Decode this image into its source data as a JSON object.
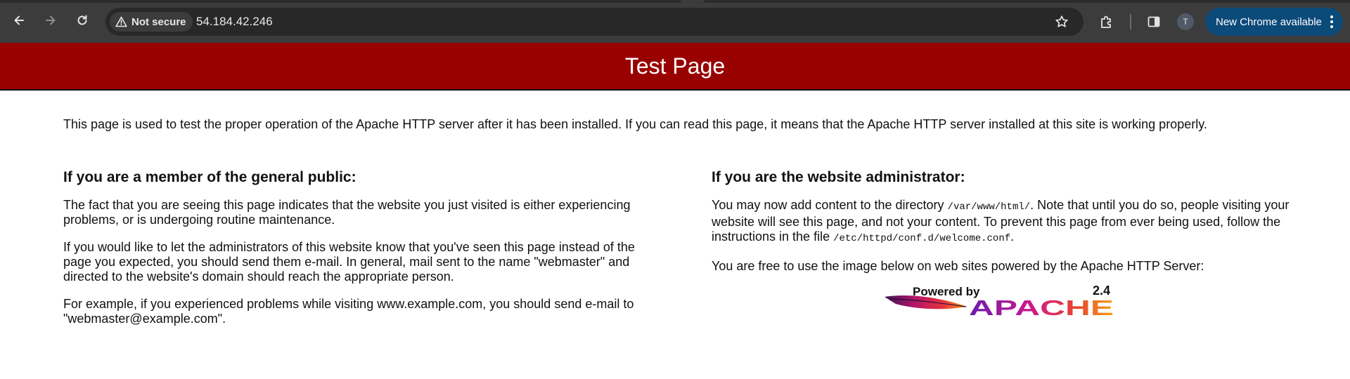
{
  "browser": {
    "nav": {
      "back_icon": "arrow-left-icon",
      "forward_icon": "arrow-right-icon",
      "reload_icon": "reload-icon"
    },
    "security_chip": {
      "label": "Not secure",
      "icon": "warning-triangle-icon"
    },
    "url": "54.184.42.246",
    "toolbar_icons": [
      "star-icon",
      "extensions-puzzle-icon",
      "side-panel-icon"
    ],
    "profile_initial": "T",
    "update_button": {
      "label": "New Chrome available",
      "icon": "kebab-menu-icon"
    },
    "colors": {
      "toolbar": "#3c3c3c",
      "omnibox": "#282828",
      "update": "#0c4a7a"
    }
  },
  "page": {
    "banner_title": "Test Page",
    "banner_color": "#990000",
    "intro": "This page is used to test the proper operation of the Apache HTTP server after it has been installed. If you can read this page, it means that the Apache HTTP server installed at this site is working properly.",
    "left": {
      "heading": "If you are a member of the general public:",
      "p1": "The fact that you are seeing this page indicates that the website you just visited is either experiencing problems, or is undergoing routine maintenance.",
      "p2": "If you would like to let the administrators of this website know that you've seen this page instead of the page you expected, you should send them e-mail. In general, mail sent to the name \"webmaster\" and directed to the website's domain should reach the appropriate person.",
      "p3": "For example, if you experienced problems while visiting www.example.com, you should send e-mail to \"webmaster@example.com\"."
    },
    "right": {
      "heading": "If you are the website administrator:",
      "p1_a": "You may now add content to the directory ",
      "p1_code1": "/var/www/html/",
      "p1_b": ". Note that until you do so, people visiting your website will see this page, and not your content. To prevent this page from ever being used, follow the instructions in the file ",
      "p1_code2": "/etc/httpd/conf.d/welcome.conf",
      "p1_c": ".",
      "p2": "You are free to use the image below on web sites powered by the Apache HTTP Server:"
    },
    "logo": {
      "powered_by": "Powered by",
      "version": "2.4",
      "brand": "APACHE"
    }
  }
}
